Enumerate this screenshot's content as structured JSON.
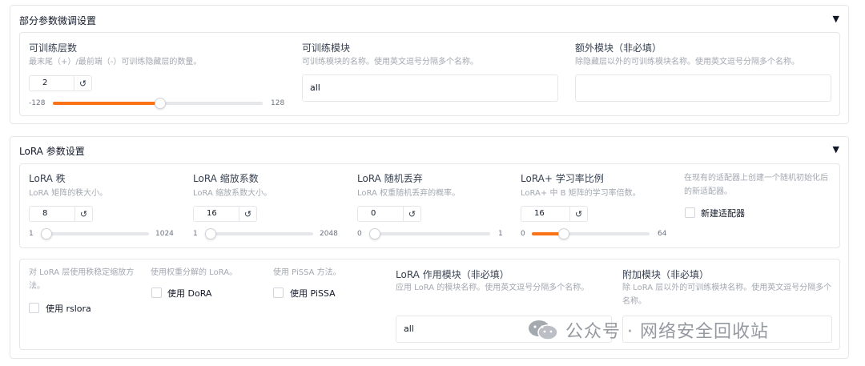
{
  "partial": {
    "title": "部分参数微调设置",
    "toggle": "▼",
    "layers": {
      "label": "可训练层数",
      "desc": "最末尾（+）/最前端（-）可训练隐藏层的数量。",
      "value": "2",
      "min": "-128",
      "max": "128",
      "level": 2
    },
    "modules": {
      "label": "可训练模块",
      "desc": "可训练模块的名称。使用英文逗号分隔多个名称。",
      "value": "all"
    },
    "extra": {
      "label": "额外模块（非必填）",
      "desc": "除隐藏层以外的可训练模块名称。使用英文逗号分隔多个名称。",
      "value": ""
    }
  },
  "lora": {
    "title": "LoRA 参数设置",
    "toggle": "▼",
    "rank": {
      "label": "LoRA 秩",
      "desc": "LoRA 矩阵的秩大小。",
      "value": "8",
      "min": "1",
      "max": "1024",
      "level": 8
    },
    "alpha": {
      "label": "LoRA 缩放系数",
      "desc": "LoRA 缩放系数大小。",
      "value": "16",
      "min": "1",
      "max": "2048",
      "level": 16
    },
    "dropout": {
      "label": "LoRA 随机丢弃",
      "desc": "LoRA 权重随机丢弃的概率。",
      "value": "0",
      "min": "0",
      "max": "1",
      "level": 0
    },
    "plus": {
      "label": "LoRA+ 学习率比例",
      "desc": "LoRA+ 中 B 矩阵的学习率倍数。",
      "value": "16",
      "min": "0",
      "max": "64",
      "level": 16
    },
    "create": {
      "desc": "在现有的适配器上创建一个随机初始化后的新适配器。",
      "label": "新建适配器"
    },
    "rslora": {
      "desc": "对 LoRA 层使用秩稳定缩放方法。",
      "label": "使用 rslora"
    },
    "dora": {
      "desc": "使用权重分解的 LoRA。",
      "label": "使用 DoRA"
    },
    "pissa": {
      "desc": "使用 PiSSA 方法。",
      "label": "使用 PiSSA"
    },
    "target": {
      "label": "LoRA 作用模块（非必填）",
      "desc": "应用 LoRA 的模块名称。使用英文逗号分隔多个名称。",
      "value": "all"
    },
    "additional": {
      "label": "附加模块（非必填）",
      "desc": "除 LoRA 层以外的可训练模块名称。使用英文逗号分隔多个名称。"
    }
  },
  "watermark": "公众号 · 网络安全回收站",
  "colors": {
    "accent": "#f97316",
    "border": "#e5e7eb",
    "muted": "#a3a8b0"
  }
}
